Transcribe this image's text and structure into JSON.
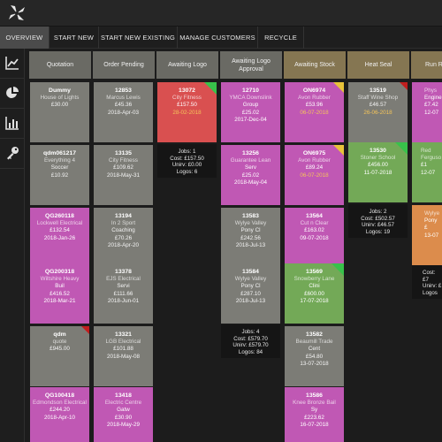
{
  "tabs": [
    {
      "label": "OVERVIEW",
      "active": true
    },
    {
      "label": "START NEW",
      "active": false
    },
    {
      "label": "START NEW EXISTING",
      "active": false
    },
    {
      "label": "MANAGE CUSTOMERS",
      "active": false
    },
    {
      "label": "RECYCLE",
      "active": false
    }
  ],
  "rail": [
    {
      "icon": "line-chart-icon"
    },
    {
      "icon": "pie-chart-icon"
    },
    {
      "icon": "bar-chart-icon"
    },
    {
      "icon": "key-icon"
    }
  ],
  "columns": [
    {
      "title": "Quotation",
      "style": "grey"
    },
    {
      "title": "Order Pending",
      "style": "grey"
    },
    {
      "title": "Awaiting Logo",
      "style": "grey"
    },
    {
      "title": "Awaiting Logo Approval",
      "style": "grey"
    },
    {
      "title": "Awaiting Stock",
      "style": "olive"
    },
    {
      "title": "Heat Seal",
      "style": "olive"
    },
    {
      "title": "Run R",
      "style": "olive"
    }
  ],
  "cards": {
    "quotation": [
      {
        "id": "Dummy",
        "name": "House of Lights",
        "amount": "£30.00",
        "date": ""
      },
      {
        "id": "qdm061217",
        "name": "Everything 4",
        "amount": "Soccer",
        "date": "£10.92"
      },
      {
        "id": "QG260118",
        "name": "Lockwell Electrical",
        "amount": "£132.54",
        "date": "2018-Jan-26"
      },
      {
        "id": "QG200318",
        "name": "Wiltshire Heavy",
        "amount": "Buil",
        "date": "£416.52",
        "extra": "2018-Mar-21"
      },
      {
        "id": "qdm",
        "name": "quote",
        "amount": "£945.00",
        "date": ""
      },
      {
        "id": "QG100418",
        "name": "Edmondson Electrical",
        "amount": "£244.20",
        "date": "2018-Apr-10"
      }
    ],
    "order_pending": [
      {
        "id": "12853",
        "name": "Marcus Lewis",
        "amount": "£45.36",
        "date": "2018-Apr-03"
      },
      {
        "id": "13135",
        "name": "City Fitness",
        "amount": "£109.62",
        "date": "2018-May-31"
      },
      {
        "id": "13194",
        "name": "In 2 Sport",
        "amount": "Coaching",
        "date": "£70.26",
        "extra": "2018-Apr-20"
      },
      {
        "id": "13378",
        "name": "EJS Electrical",
        "amount": "Servi",
        "date": "£111.66",
        "extra": "2018-Jun-01"
      },
      {
        "id": "13321",
        "name": "LGB Electrical",
        "amount": "£101.88",
        "date": "2018-May-08"
      },
      {
        "id": "13418",
        "name": "Electric Centre",
        "amount": "Gatw",
        "date": "£30.90",
        "extra": "2018-May-29"
      }
    ],
    "awaiting_logo": [
      {
        "id": "13072",
        "name": "City Fitness",
        "amount": "£157.50",
        "date": "28-02-2018"
      }
    ],
    "awaiting_logo_summary": [
      "Jobs: 1",
      "Cost: £157.50",
      "Unirv: £0.00",
      "Logos: 6"
    ],
    "awaiting_logo_approval": [
      {
        "id": "12710",
        "name": "YMCA Downslink",
        "amount": "Group",
        "date": "£25.02",
        "extra": "2017-Dec-04"
      },
      {
        "id": "13256",
        "name": "Guarantee Lean",
        "amount": "Serv",
        "date": "£25.02",
        "extra": "2018-May-04"
      },
      {
        "id": "13583",
        "name": "Wylye Valley",
        "amount": "Pony Cl",
        "date": "£242.56",
        "extra": "2018-Jul-13"
      },
      {
        "id": "13584",
        "name": "Wylye Valley",
        "amount": "Pony Cl",
        "date": "£287.10",
        "extra": "2018-Jul-13"
      }
    ],
    "awaiting_logo_approval_summary": [
      "Jobs: 4",
      "Cost: £579.70",
      "Unirv: £579.70",
      "Logos: 84"
    ],
    "awaiting_stock": [
      {
        "id": "ON6974",
        "name": "Avon Rubber",
        "amount": "£53.96",
        "date": "06-07-2018"
      },
      {
        "id": "ON6975",
        "name": "Avon Rubber",
        "amount": "£89.24",
        "date": "06-07-2018"
      },
      {
        "id": "13564",
        "name": "Cut n Clear",
        "amount": "£163.02",
        "date": "09-07-2018"
      },
      {
        "id": "13569",
        "name": "Snowberry Lane",
        "amount": "Clini",
        "date": "£600.00",
        "extra": "17-07-2018"
      },
      {
        "id": "13582",
        "name": "Beaumill Trade",
        "amount": "Cent",
        "date": "£54.80",
        "extra": "13-07-2018"
      },
      {
        "id": "13586",
        "name": "Knee Bronze Bail",
        "amount": "Sy",
        "date": "£223.62",
        "extra": "16-07-2018"
      }
    ],
    "heat_seal": [
      {
        "id": "13519",
        "name": "Staff Wine Shop",
        "amount": "£46.57",
        "date": "26-06-2018"
      },
      {
        "id": "13530",
        "name": "Stoner School",
        "amount": "£456.00",
        "date": "11-07-2018"
      }
    ],
    "heat_seal_summary": [
      "Jobs: 2",
      "Cost: £502.57",
      "Unirv: £46.57",
      "Logos: 19"
    ],
    "run_r": [
      {
        "id": "",
        "name": "Phys",
        "amount": "Engine",
        "date": "£7.42",
        "extra": "12-07"
      },
      {
        "id": "",
        "name": "Red Ferguso",
        "amount": "£1",
        "date": "12-07"
      },
      {
        "id": "",
        "name": "Wylye",
        "amount": "Pony",
        "date": "£",
        "extra": "13-07"
      },
      {
        "id": "",
        "name": "",
        "amount": "",
        "date": ""
      }
    ],
    "run_r_summary": [
      "Cost: £7",
      "Unirv: £",
      "Logos"
    ]
  },
  "colors": {
    "grey_card": "#7c7c76",
    "pink_card": "#c058b4",
    "red_card": "#d95050",
    "green_card": "#73a957",
    "orange_card": "#dc8c4c",
    "flag_green": "#38c24a",
    "flag_yellow": "#e8c33a",
    "flag_red": "#c01e1e"
  }
}
